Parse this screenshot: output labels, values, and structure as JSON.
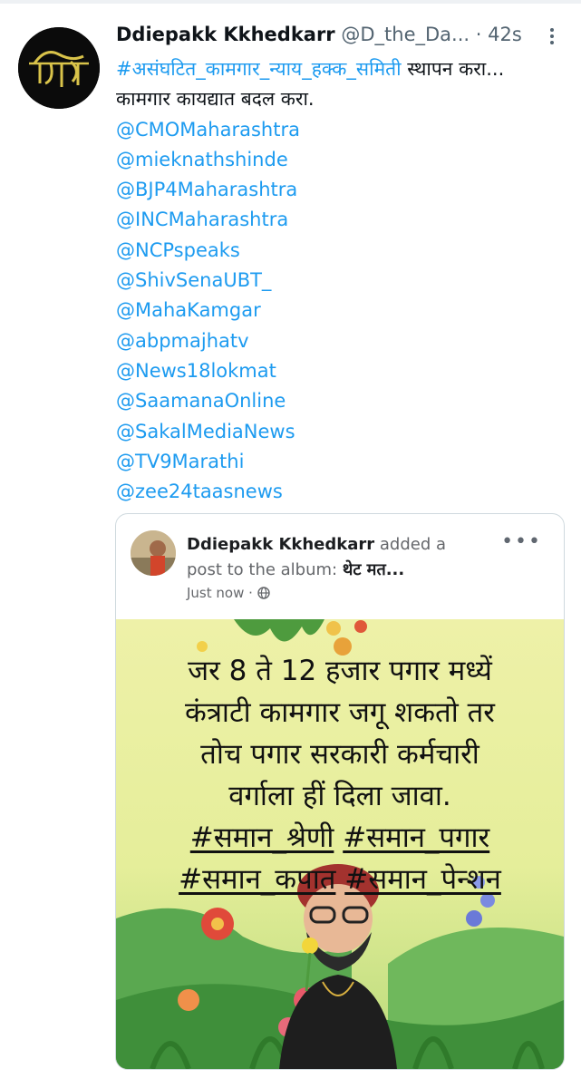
{
  "tweet": {
    "author_name": "Ddiepakk Kkhedkarr",
    "handle": "@D_the_Da...",
    "separator": "·",
    "time": "42s",
    "hashtag": "#असंघटित_कामगार_न्याय_हक्क_समिती",
    "line1_rest": " स्थापन करा...",
    "line2": "कामगार कायद्यात बदल करा.",
    "mentions": [
      "@CMOMaharashtra",
      "@mieknathshinde",
      "@BJP4Maharashtra",
      "@INCMaharashtra",
      "@NCPspeaks",
      "@ShivSenaUBT_",
      "@MahaKamgar",
      "@abpmajhatv",
      "@News18lokmat",
      "@SaamanaOnline",
      "@SakalMediaNews",
      "@TV9Marathi",
      "@zee24taasnews"
    ]
  },
  "card": {
    "author_name": "Ddiepakk Kkhedkarr",
    "action": " added a post to the album: ",
    "album": "थेट मत...",
    "time": "Just now",
    "time_sep": " · ",
    "more": "•••",
    "image_text": {
      "line1": "जर 8 ते 12 हजार पगार मध्यें",
      "line2": "कंत्राटी कामगार जगू शकतो तर",
      "line3": "तोच पगार सरकारी कर्मचारी",
      "line4": "वर्गाला हीं दिला जावा.",
      "tag1": "#समान_श्रेणी",
      "tag2": "#समान_पगार",
      "tag3": "#समान_कपात",
      "tag4": "#समान_पेन्शन"
    }
  },
  "colors": {
    "link": "#1d9bf0",
    "secondary_text": "#536471",
    "image_bg_top": "#eef1a8",
    "image_bg_bottom": "#cfe48a"
  },
  "icons": [
    "more-vertical-icon",
    "globe-icon",
    "more-horizontal-icon"
  ]
}
